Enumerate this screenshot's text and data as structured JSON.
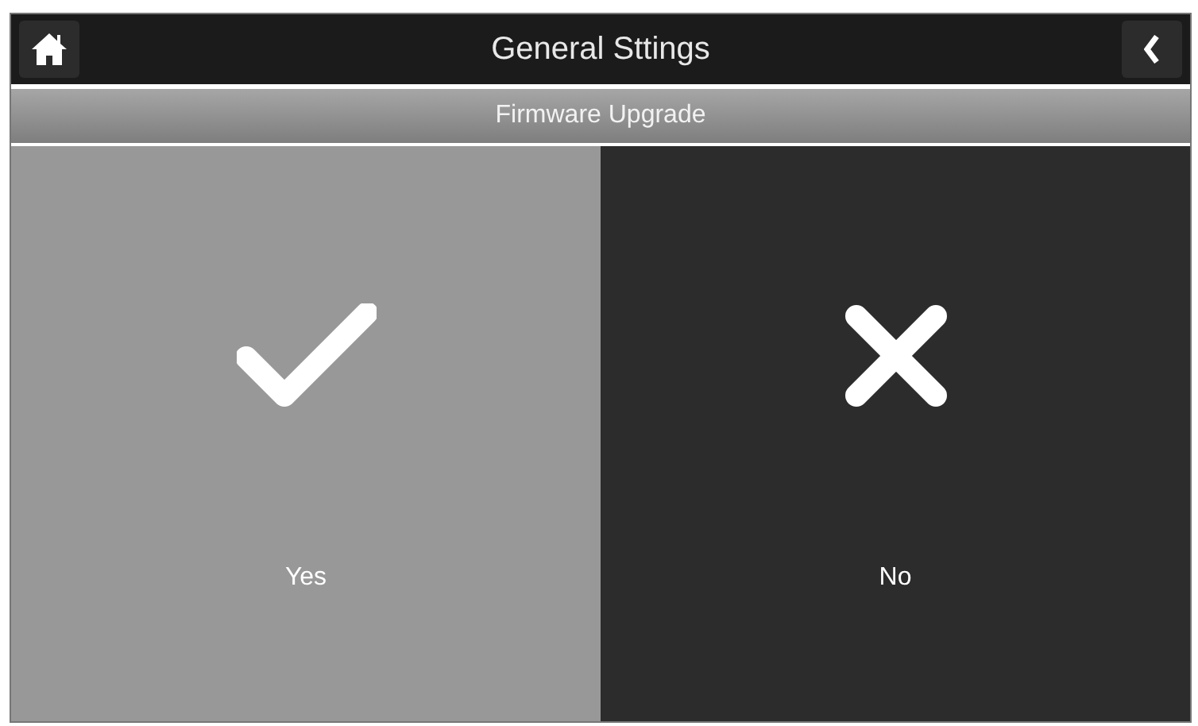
{
  "window": {
    "title": "General Sttings"
  },
  "subtitle": "Firmware Upgrade",
  "options": [
    {
      "label": "Yes",
      "kind": "check",
      "selected": true
    },
    {
      "label": "No",
      "kind": "cross",
      "selected": false
    }
  ]
}
